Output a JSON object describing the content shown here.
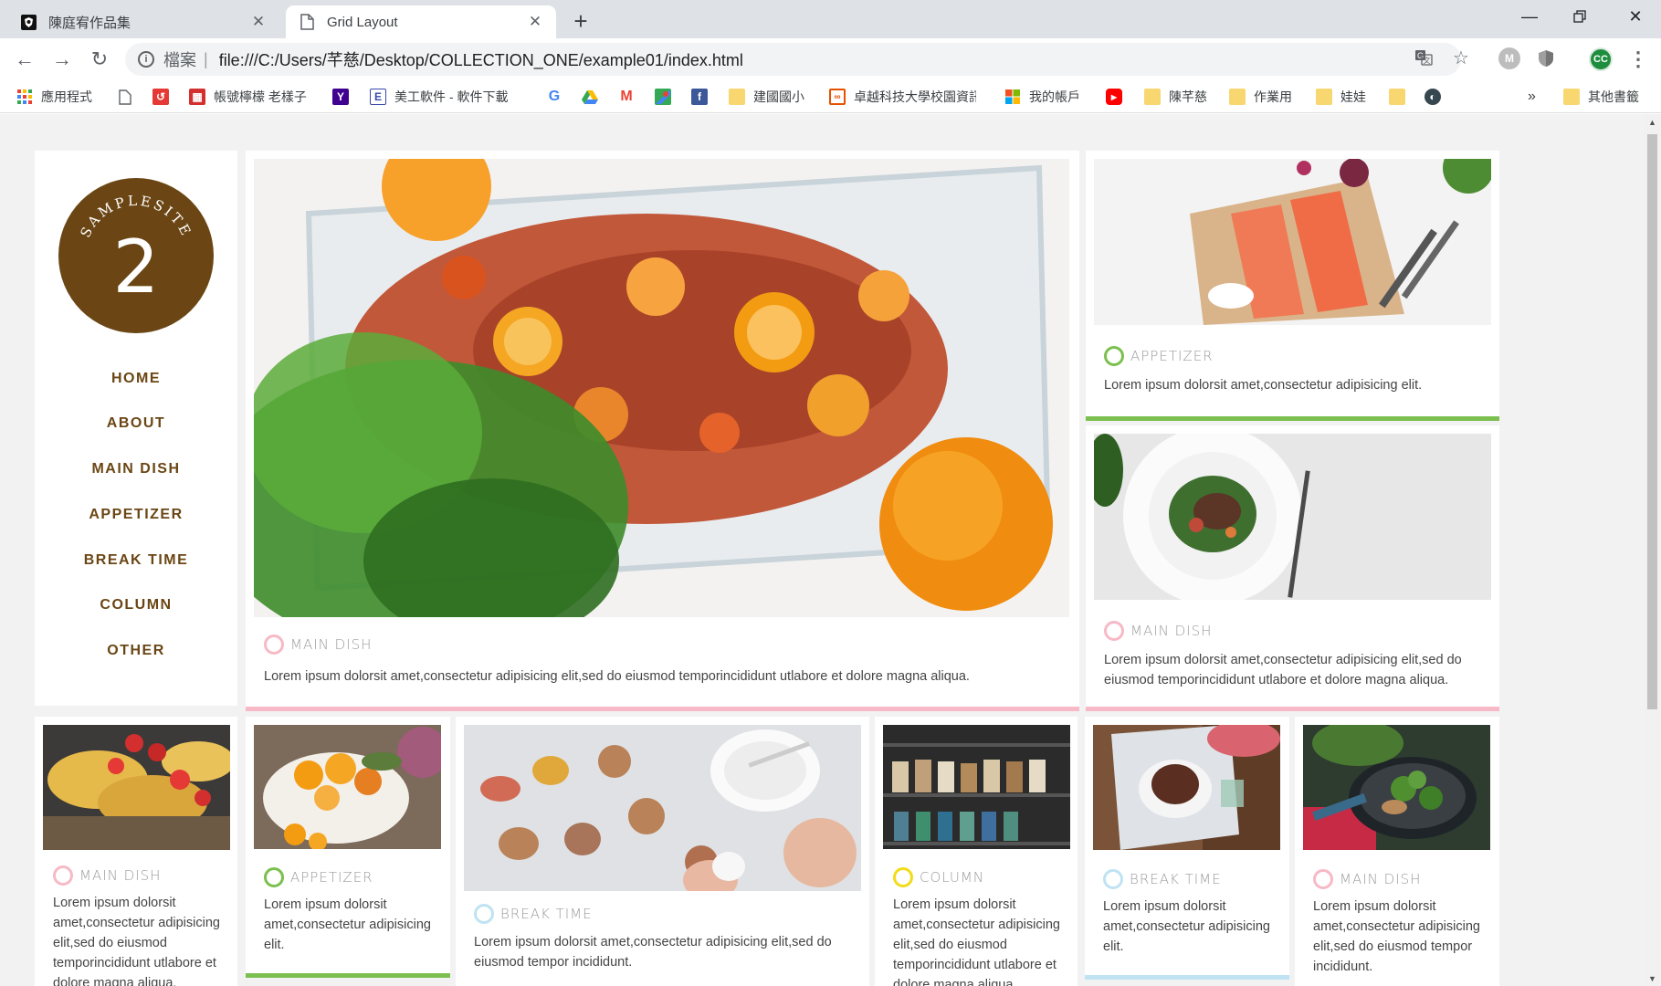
{
  "browser": {
    "tabs": [
      {
        "title": "陳庭宥作品集",
        "active": false
      },
      {
        "title": "Grid Layout",
        "active": true
      }
    ],
    "scheme_label": "檔案",
    "url": "file:///C:/Users/芊慈/Desktop/COLLECTION_ONE/example01/index.html",
    "profile_initials": "CC",
    "bookmarks": [
      {
        "label": "應用程式",
        "icon": "apps-grid-icon"
      },
      {
        "label": "",
        "icon": "page-icon"
      },
      {
        "label": "",
        "icon": "red-logo-icon"
      },
      {
        "label": "帳號檸檬 老樣子",
        "icon": "red-grid-icon"
      },
      {
        "label": "",
        "icon": "yahoo-icon"
      },
      {
        "label": "美工軟件 - 軟件下載",
        "icon": "e-icon"
      },
      {
        "label": "",
        "icon": "google-icon"
      },
      {
        "label": "",
        "icon": "drive-icon"
      },
      {
        "label": "",
        "icon": "gmail-icon"
      },
      {
        "label": "",
        "icon": "maps-icon"
      },
      {
        "label": "",
        "icon": "facebook-icon"
      },
      {
        "label": "建國國小",
        "icon": "folder-icon"
      },
      {
        "label": "卓越科技大學校園資訊",
        "icon": "school-icon"
      },
      {
        "label": "我的帳戶",
        "icon": "microsoft-icon"
      },
      {
        "label": "",
        "icon": "youtube-icon"
      },
      {
        "label": "陳芊慈",
        "icon": "folder-icon"
      },
      {
        "label": "作業用",
        "icon": "folder-icon"
      },
      {
        "label": "娃娃",
        "icon": "folder-icon"
      },
      {
        "label": "",
        "icon": "folder-icon"
      },
      {
        "label": "",
        "icon": "globe-icon"
      }
    ],
    "overflow_label": "»",
    "other_bookmarks": "其他書籤"
  },
  "sidebar": {
    "logo_text": "SAMPLESITE",
    "logo_number": "2",
    "nav": [
      "HOME",
      "ABOUT",
      "MAIN DISH",
      "APPETIZER",
      "BREAK TIME",
      "COLUMN",
      "OTHER"
    ]
  },
  "colors": {
    "main_dish": "#f7b9c6",
    "appetizer": "#7bc04f",
    "break_time": "#bfe3f2",
    "column": "#f2dc1a",
    "brand": "#6b4614"
  },
  "cards": [
    {
      "category": "MAIN DISH",
      "text": "Lorem ipsum dolorsit amet,consectetur adipisicing elit,sed do eiusmod temporincididunt utlabore et dolore magna aliqua."
    },
    {
      "category": "APPETIZER",
      "text": "Lorem ipsum dolorsit amet,consectetur adipisicing elit."
    },
    {
      "category": "MAIN DISH",
      "text": "Lorem ipsum dolorsit amet,consectetur adipisicing elit,sed do eiusmod temporincididunt utlabore et dolore magna aliqua."
    },
    {
      "category": "MAIN DISH",
      "text": "Lorem ipsum dolorsit amet,consectetur adipisicing elit,sed do eiusmod temporincididunt utlabore et dolore magna aliqua."
    },
    {
      "category": "APPETIZER",
      "text": "Lorem ipsum dolorsit amet,consectetur adipisicing elit."
    },
    {
      "category": "BREAK TIME",
      "text": "Lorem ipsum dolorsit amet,consectetur adipisicing elit,sed do eiusmod tempor incididunt."
    },
    {
      "category": "COLUMN",
      "text": "Lorem ipsum dolorsit amet,consectetur adipisicing elit,sed do eiusmod temporincididunt utlabore et dolore magna aliqua."
    },
    {
      "category": "BREAK TIME",
      "text": "Lorem ipsum dolorsit amet,consectetur adipisicing elit."
    },
    {
      "category": "MAIN DISH",
      "text": "Lorem ipsum dolorsit amet,consectetur adipisicing elit,sed do eiusmod tempor incididunt."
    }
  ]
}
